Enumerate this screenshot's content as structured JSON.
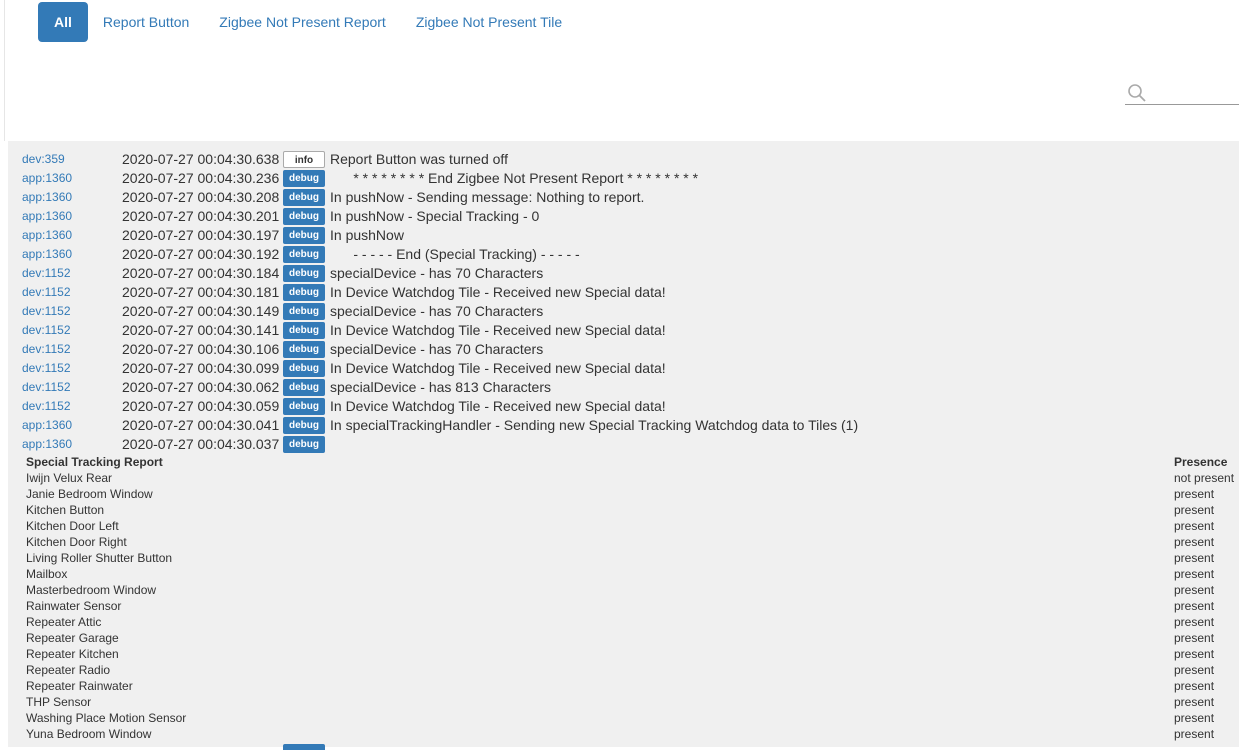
{
  "tabs": [
    {
      "label": "All",
      "active": true
    },
    {
      "label": "Report Button",
      "active": false
    },
    {
      "label": "Zigbee Not Present Report",
      "active": false
    },
    {
      "label": "Zigbee Not Present Tile",
      "active": false
    }
  ],
  "search": {
    "placeholder": "",
    "icon": "search-icon"
  },
  "log_rows": [
    {
      "src": "dev:359",
      "time": "2020-07-27 00:04:30.638",
      "level": "info",
      "msg": "Report Button was turned off"
    },
    {
      "src": "app:1360",
      "time": "2020-07-27 00:04:30.236",
      "level": "debug",
      "msg": "      * * * * * * * * End Zigbee Not Present Report * * * * * * * *"
    },
    {
      "src": "app:1360",
      "time": "2020-07-27 00:04:30.208",
      "level": "debug",
      "msg": "In pushNow - Sending message: Nothing to report."
    },
    {
      "src": "app:1360",
      "time": "2020-07-27 00:04:30.201",
      "level": "debug",
      "msg": "In pushNow - Special Tracking - 0"
    },
    {
      "src": "app:1360",
      "time": "2020-07-27 00:04:30.197",
      "level": "debug",
      "msg": "In pushNow"
    },
    {
      "src": "app:1360",
      "time": "2020-07-27 00:04:30.192",
      "level": "debug",
      "msg": "      - - - - - End (Special Tracking) - - - - -"
    },
    {
      "src": "dev:1152",
      "time": "2020-07-27 00:04:30.184",
      "level": "debug",
      "msg": "specialDevice - has 70 Characters"
    },
    {
      "src": "dev:1152",
      "time": "2020-07-27 00:04:30.181",
      "level": "debug",
      "msg": "In Device Watchdog Tile - Received new Special data!"
    },
    {
      "src": "dev:1152",
      "time": "2020-07-27 00:04:30.149",
      "level": "debug",
      "msg": "specialDevice - has 70 Characters"
    },
    {
      "src": "dev:1152",
      "time": "2020-07-27 00:04:30.141",
      "level": "debug",
      "msg": "In Device Watchdog Tile - Received new Special data!"
    },
    {
      "src": "dev:1152",
      "time": "2020-07-27 00:04:30.106",
      "level": "debug",
      "msg": "specialDevice - has 70 Characters"
    },
    {
      "src": "dev:1152",
      "time": "2020-07-27 00:04:30.099",
      "level": "debug",
      "msg": "In Device Watchdog Tile - Received new Special data!"
    },
    {
      "src": "dev:1152",
      "time": "2020-07-27 00:04:30.062",
      "level": "debug",
      "msg": "specialDevice - has 813 Characters"
    },
    {
      "src": "dev:1152",
      "time": "2020-07-27 00:04:30.059",
      "level": "debug",
      "msg": "In Device Watchdog Tile - Received new Special data!"
    },
    {
      "src": "app:1360",
      "time": "2020-07-27 00:04:30.041",
      "level": "debug",
      "msg": "In specialTrackingHandler - Sending new Special Tracking Watchdog data to Tiles (1)"
    },
    {
      "src": "app:1360",
      "time": "2020-07-27 00:04:30.037",
      "level": "debug",
      "msg": ""
    }
  ],
  "report": {
    "headers": [
      "Special Tracking Report",
      "Presence"
    ],
    "rows": [
      [
        "Iwijn Velux Rear",
        "not present"
      ],
      [
        "Janie Bedroom Window",
        "present"
      ],
      [
        "Kitchen Button",
        "present"
      ],
      [
        "Kitchen Door Left",
        "present"
      ],
      [
        "Kitchen Door Right",
        "present"
      ],
      [
        "Living Roller Shutter Button",
        "present"
      ],
      [
        "Mailbox",
        "present"
      ],
      [
        "Masterbedroom Window",
        "present"
      ],
      [
        "Rainwater Sensor",
        "present"
      ],
      [
        "Repeater Attic",
        "present"
      ],
      [
        "Repeater Garage",
        "present"
      ],
      [
        "Repeater Kitchen",
        "present"
      ],
      [
        "Repeater Radio",
        "present"
      ],
      [
        "Repeater Rainwater",
        "present"
      ],
      [
        "THP Sensor",
        "present"
      ],
      [
        "Washing Place Motion Sensor",
        "present"
      ],
      [
        "Yuna Bedroom Window",
        "present"
      ]
    ]
  },
  "colors": {
    "accent": "#337ab7",
    "log_bg": "#f0f0f0"
  }
}
